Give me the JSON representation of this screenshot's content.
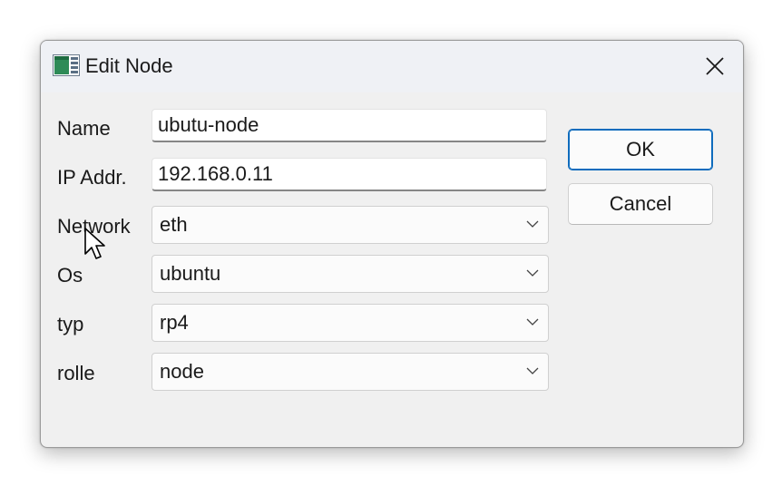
{
  "window": {
    "title": "Edit Node",
    "app_icon": "window-app-icon",
    "close_icon": "close-icon"
  },
  "fields": [
    {
      "label": "Name",
      "type": "text",
      "value": "ubutu-node"
    },
    {
      "label": "IP Addr.",
      "type": "text",
      "value": "192.168.0.11"
    },
    {
      "label": "Network",
      "type": "select",
      "value": "eth"
    },
    {
      "label": "Os",
      "type": "select",
      "value": "ubuntu"
    },
    {
      "label": "typ",
      "type": "select",
      "value": "rp4"
    },
    {
      "label": "rolle",
      "type": "select",
      "value": "node"
    }
  ],
  "buttons": {
    "ok": "OK",
    "cancel": "Cancel"
  },
  "colors": {
    "dialog_bg": "#f0f0f0",
    "titlebar_bg": "#eff1f5",
    "default_button_border": "#0f6cbd"
  }
}
